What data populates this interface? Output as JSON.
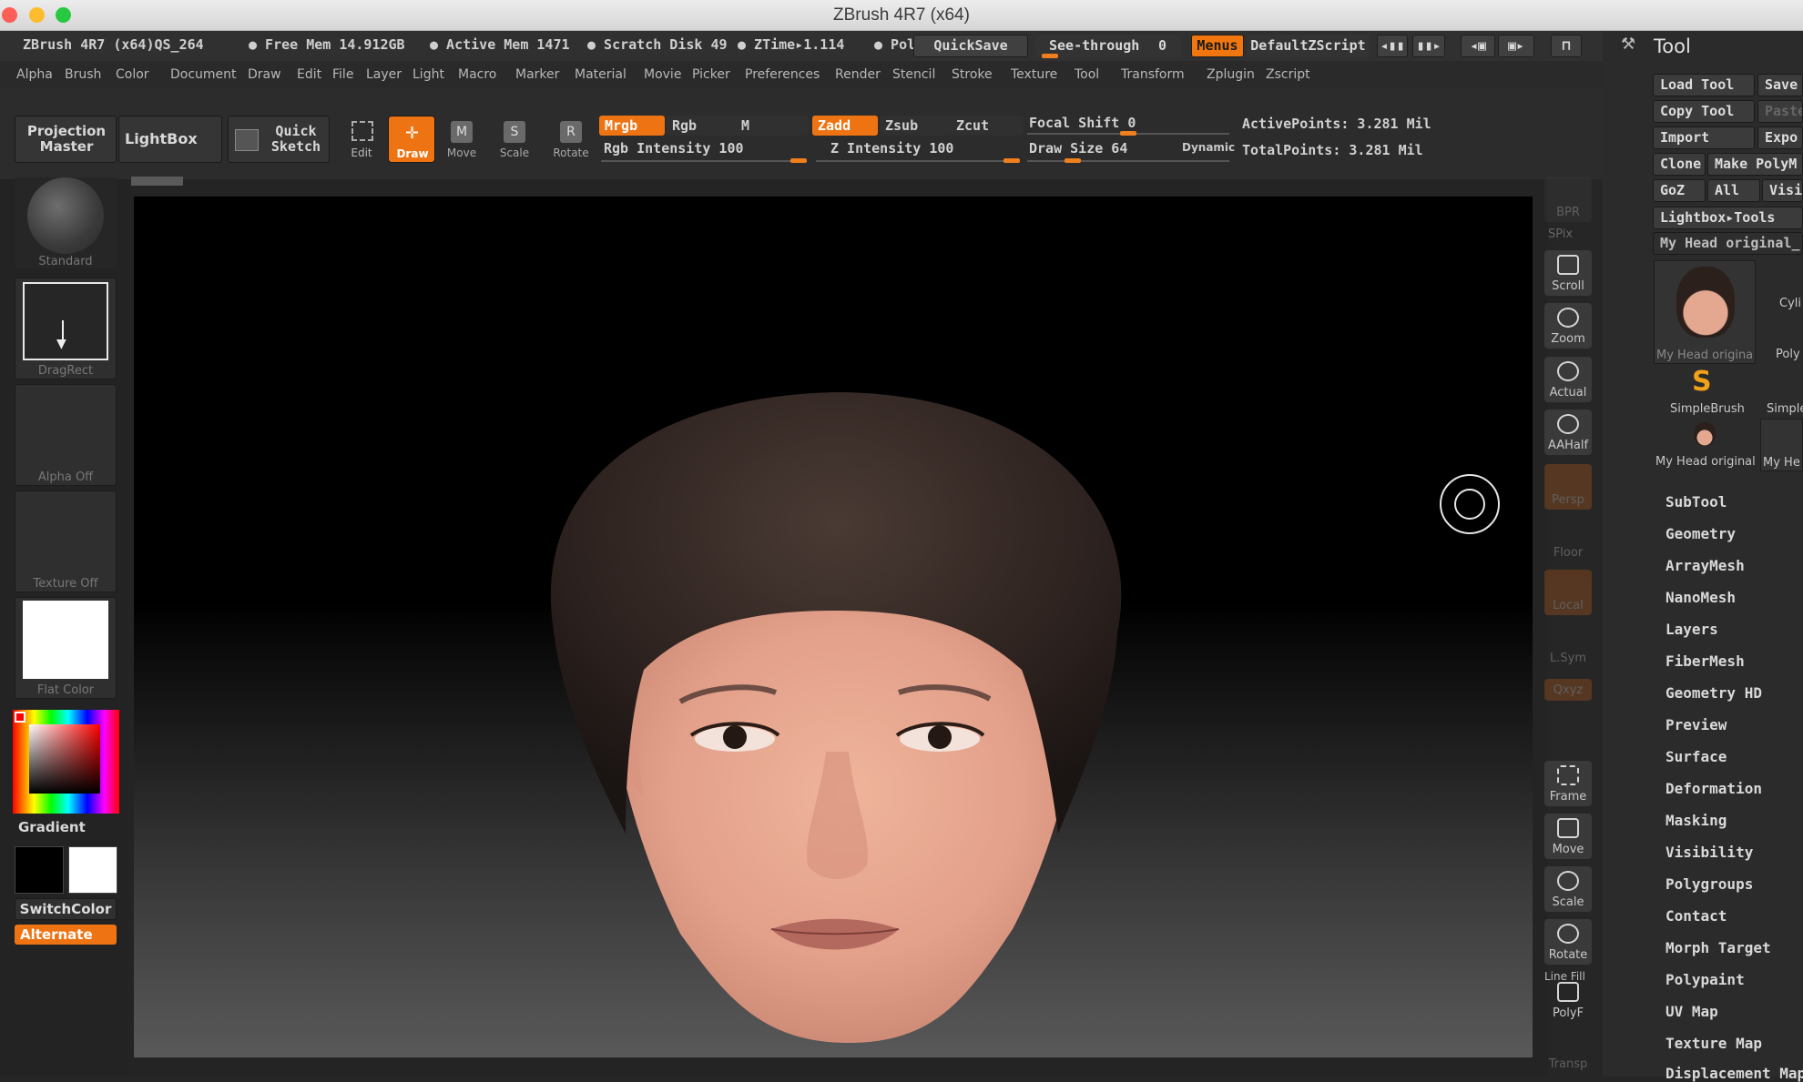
{
  "window": {
    "title": "ZBrush 4R7 (x64)"
  },
  "infobar": {
    "app": "ZBrush 4R7 (x64)QS_264",
    "free_mem": "● Free Mem 14.912GB",
    "active_mem": "● Active Mem 1471",
    "scratch": "● Scratch Disk 49",
    "ztime": "● ZTime▸1.114",
    "pol": "● Pol",
    "quicksave": "QuickSave",
    "see_through": "See-through",
    "see_through_value": "0",
    "menus": "Menus",
    "default_zscript": "DefaultZScript"
  },
  "menubar": [
    "Alpha",
    "Brush",
    "Color",
    "Document",
    "Draw",
    "Edit",
    "File",
    "Layer",
    "Light",
    "Macro",
    "Marker",
    "Material",
    "Movie",
    "Picker",
    "Preferences",
    "Render",
    "Stencil",
    "Stroke",
    "Texture",
    "Tool",
    "Transform",
    "Zplugin",
    "Zscript"
  ],
  "toolbar": {
    "projection_master": "Projection Master",
    "lightbox": "LightBox",
    "quick_sketch": "Quick Sketch",
    "edit": "Edit",
    "draw": "Draw",
    "move": "Move",
    "scale": "Scale",
    "rotate": "Rotate",
    "mrgb": "Mrgb",
    "rgb": "Rgb",
    "m": "M",
    "zadd": "Zadd",
    "zsub": "Zsub",
    "zcut": "Zcut",
    "rgb_intensity": "Rgb Intensity 100",
    "z_intensity": "Z Intensity 100",
    "focal_shift": "Focal Shift 0",
    "draw_size": "Draw Size 64",
    "dynamic": "Dynamic",
    "active_points": "ActivePoints: 3.281 Mil",
    "total_points": "TotalPoints: 3.281 Mil"
  },
  "levels": {
    "rgb_intensity": 1.0,
    "z_intensity": 1.0,
    "focal_shift": 0.5,
    "draw_size": 0.2
  },
  "leftshelf": {
    "standard": "Standard",
    "dragrect": "DragRect",
    "alpha": "Alpha  Off",
    "texture": "Texture  Off",
    "flat_color": "Flat  Color",
    "gradient": "Gradient",
    "switchcolor": "SwitchColor",
    "alternate": "Alternate"
  },
  "rightshelf": {
    "bpr": "BPR",
    "spix": "SPix",
    "scroll": "Scroll",
    "zoom": "Zoom",
    "actual": "Actual",
    "aahalf": "AAHalf",
    "persp": "Persp",
    "floor": "Floor",
    "local": "Local",
    "lsym": "L.Sym",
    "xyz": "Qxyz",
    "frame": "Frame",
    "move": "Move",
    "scale": "Scale",
    "rotate": "Rotate",
    "line_fill": "Line Fill",
    "polyf": "PolyF",
    "transp": "Transp"
  },
  "tool": {
    "title": "Tool",
    "load_tool": "Load Tool",
    "save": "Save",
    "copy_tool": "Copy Tool",
    "paste": "Paste",
    "import": "Import",
    "export": "Expo",
    "clone": "Clone",
    "make_polymesh": "Make PolyM",
    "goz": "GoZ",
    "all": "All",
    "visible": "Visib",
    "lightbox_tools": "Lightbox▸Tools",
    "current_tool": "My Head original_",
    "thumbs": {
      "my_head": "My  Head  origina",
      "cyl": "Cyli",
      "poly": "Poly",
      "simplebrush": "SimpleBrush",
      "simple2": "Simple",
      "my_head2": "My  Head  original",
      "my_he": "My  He"
    },
    "subpalettes": [
      "SubTool",
      "Geometry",
      "ArrayMesh",
      "NanoMesh",
      "Layers",
      "FiberMesh",
      "Geometry HD",
      "Preview",
      "Surface",
      "Deformation",
      "Masking",
      "Visibility",
      "Polygroups",
      "Contact",
      "Morph Target",
      "Polypaint",
      "UV Map",
      "Texture Map",
      "Displacement Map"
    ]
  },
  "colors": {
    "accent": "#f07f1d",
    "main_color": "#ffffff",
    "secondary_color": "#000000"
  }
}
